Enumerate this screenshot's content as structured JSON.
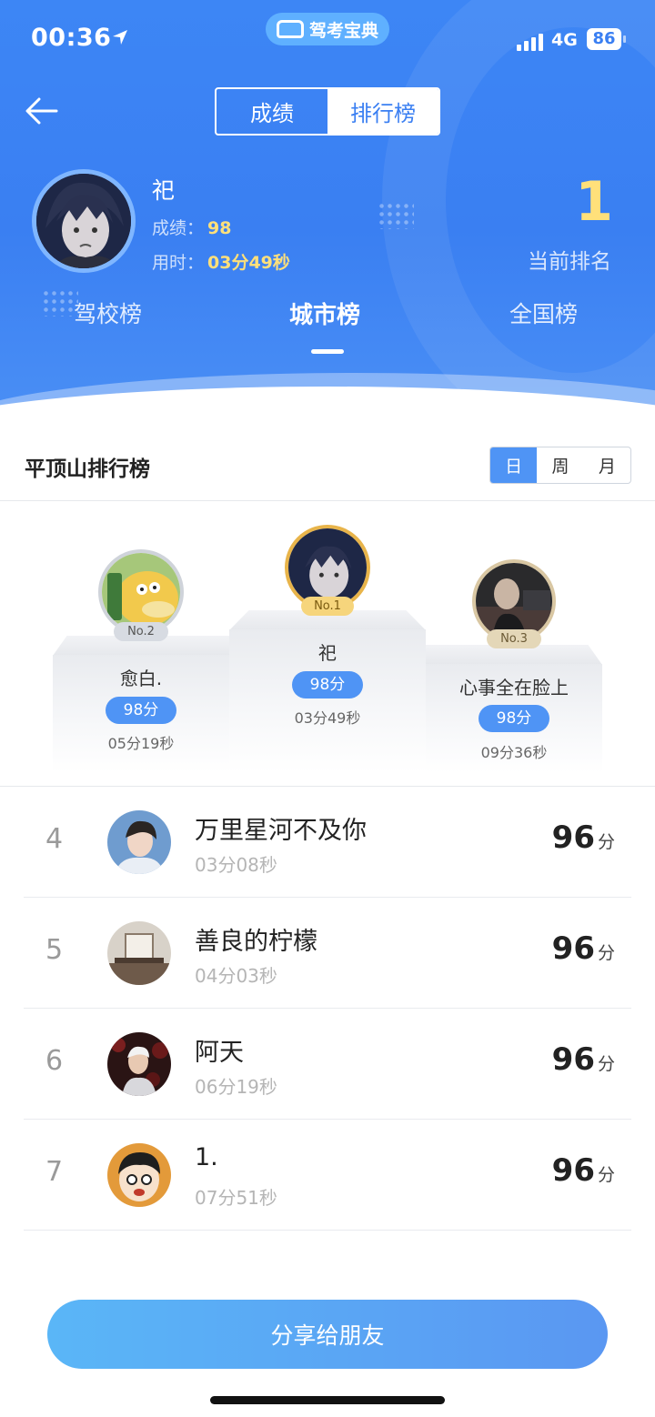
{
  "status_bar": {
    "time": "00:36",
    "network": "4G",
    "battery": "86"
  },
  "brand": {
    "name": "驾考宝典"
  },
  "header": {
    "segments": [
      {
        "label": "成绩",
        "active": false
      },
      {
        "label": "排行榜",
        "active": true
      }
    ]
  },
  "me": {
    "name": "祀",
    "score_label": "成绩：",
    "score": "98",
    "time_label": "用时：",
    "time": "03分49秒",
    "rank": "1",
    "rank_label": "当前排名"
  },
  "tabs": [
    {
      "label": "驾校榜",
      "active": false
    },
    {
      "label": "城市榜",
      "active": true
    },
    {
      "label": "全国榜",
      "active": false
    }
  ],
  "board": {
    "title": "平顶山排行榜",
    "periods": [
      {
        "label": "日",
        "active": true
      },
      {
        "label": "周",
        "active": false
      },
      {
        "label": "月",
        "active": false
      }
    ]
  },
  "podium": {
    "first": {
      "tag": "No.1",
      "name": "祀",
      "score": "98分",
      "time": "03分49秒"
    },
    "second": {
      "tag": "No.2",
      "name": "愈白.",
      "score": "98分",
      "time": "05分19秒"
    },
    "third": {
      "tag": "No.3",
      "name": "心事全在脸上",
      "score": "98分",
      "time": "09分36秒"
    }
  },
  "list": [
    {
      "rank": "4",
      "name": "万里星河不及你",
      "time": "03分08秒",
      "score": "96",
      "unit": "分"
    },
    {
      "rank": "5",
      "name": "善良的柠檬",
      "time": "04分03秒",
      "score": "96",
      "unit": "分"
    },
    {
      "rank": "6",
      "name": "阿天",
      "time": "06分19秒",
      "score": "96",
      "unit": "分"
    },
    {
      "rank": "7",
      "name": "1.",
      "time": "07分51秒",
      "score": "96",
      "unit": "分"
    }
  ],
  "share_button": "分享给朋友",
  "colors": {
    "primary": "#3a7ff2",
    "accent_yellow": "#ffe07a",
    "score_pill": "#4f94f5"
  }
}
